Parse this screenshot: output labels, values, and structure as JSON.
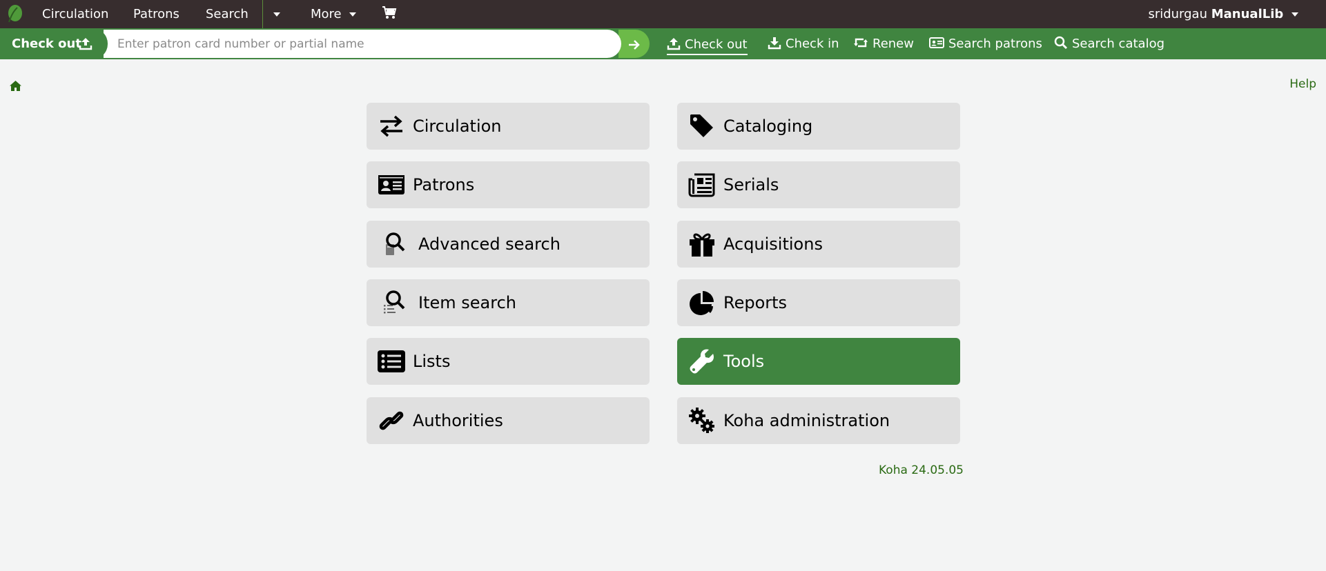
{
  "topnav": {
    "logo_icon": "koha-leaf-icon",
    "links": {
      "circulation": "Circulation",
      "patrons": "Patrons",
      "search": "Search",
      "more": "More"
    },
    "cart_icon": "cart-icon",
    "user": {
      "username": "sridurgau",
      "library": "ManualLib"
    }
  },
  "circbar": {
    "active_label": "Check out",
    "placeholder": "Enter patron card number or partial name",
    "value": "",
    "tools": {
      "checkout": "Check out",
      "checkin": "Check in",
      "renew": "Renew",
      "search_patrons": "Search patrons",
      "search_catalog": "Search catalog"
    }
  },
  "breadcrumb": {
    "home_icon": "home-icon"
  },
  "help": "Help",
  "modules": {
    "circulation": "Circulation",
    "cataloging": "Cataloging",
    "patrons": "Patrons",
    "serials": "Serials",
    "advanced_search": "Advanced search",
    "acquisitions": "Acquisitions",
    "item_search": "Item search",
    "reports": "Reports",
    "lists": "Lists",
    "tools": "Tools",
    "authorities": "Authorities",
    "koha_administration": "Koha administration"
  },
  "version": "Koha 24.05.05",
  "colors": {
    "nav_bg": "#372d2e",
    "green": "#408540",
    "go_button": "#6cba48",
    "tile_bg": "#e0e0e0",
    "link_green": "#2a6a13"
  }
}
